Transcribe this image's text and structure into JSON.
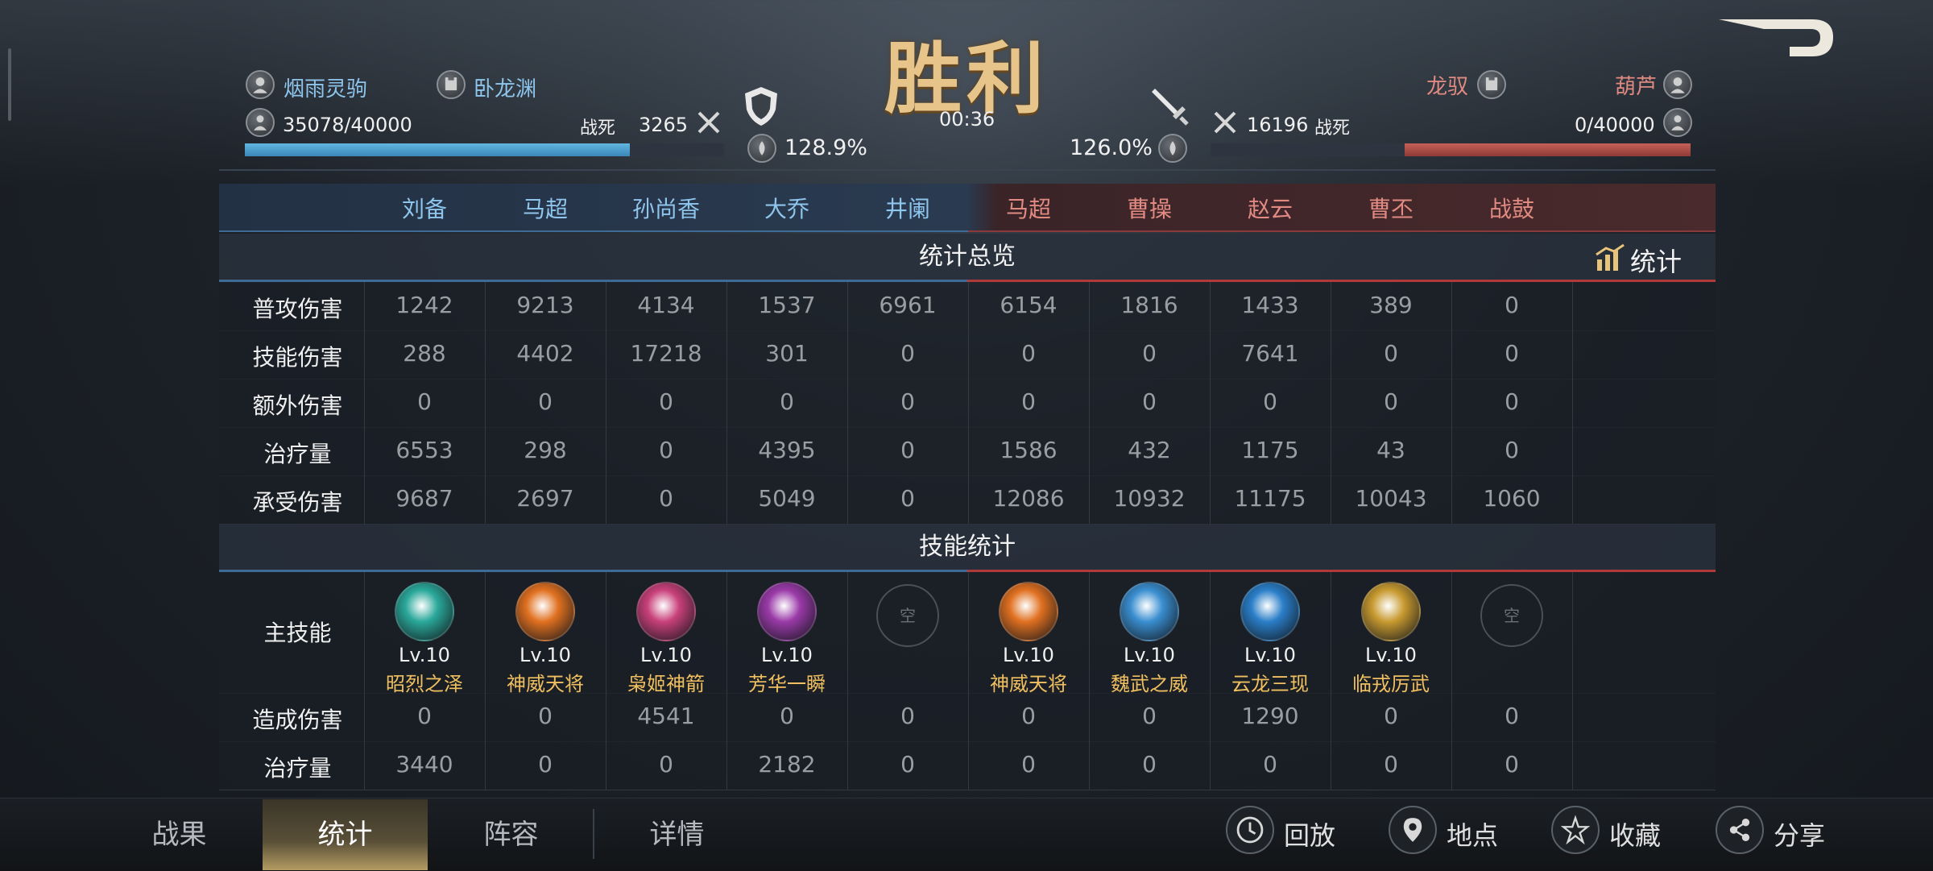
{
  "title": "胜利",
  "timer": "00:36",
  "left_team": {
    "player1": "烟雨灵驹",
    "player2": "卧龙渊",
    "troops": "35078/40000",
    "troops_fraction": 0.877,
    "kills_label": "战死",
    "kills_value": "3265",
    "percent": "128.9%"
  },
  "right_team": {
    "player1": "龙驭",
    "player2": "葫芦",
    "troops": "0/40000",
    "troops_fraction": 0.0,
    "kills_label": "战死",
    "kills_value": "16196",
    "percent": "126.0%"
  },
  "columns": [
    "刘备",
    "马超",
    "孙尚香",
    "大乔",
    "井阑",
    "马超",
    "曹操",
    "赵云",
    "曹丕",
    "战鼓"
  ],
  "overview": {
    "title": "统计总览",
    "stats_button": "统计",
    "rows": [
      {
        "label": "普攻伤害",
        "values": [
          "1242",
          "9213",
          "4134",
          "1537",
          "6961",
          "6154",
          "1816",
          "1433",
          "389",
          "0"
        ]
      },
      {
        "label": "技能伤害",
        "values": [
          "288",
          "4402",
          "17218",
          "301",
          "0",
          "0",
          "0",
          "7641",
          "0",
          "0"
        ]
      },
      {
        "label": "额外伤害",
        "values": [
          "0",
          "0",
          "0",
          "0",
          "0",
          "0",
          "0",
          "0",
          "0",
          "0"
        ]
      },
      {
        "label": "治疗量",
        "values": [
          "6553",
          "298",
          "0",
          "4395",
          "0",
          "1586",
          "432",
          "1175",
          "43",
          "0"
        ]
      },
      {
        "label": "承受伤害",
        "values": [
          "9687",
          "2697",
          "0",
          "5049",
          "0",
          "12086",
          "10932",
          "11175",
          "10043",
          "1060"
        ]
      }
    ]
  },
  "skills": {
    "title": "技能统计",
    "main_label": "主技能",
    "empty_text": "空",
    "entries": [
      {
        "lv": "Lv.10",
        "name": "昭烈之泽",
        "icon": "teal-sword-icon",
        "color": "#2aa89a"
      },
      {
        "lv": "Lv.10",
        "name": "神威天将",
        "icon": "fire-warrior-icon",
        "color": "#e07020"
      },
      {
        "lv": "Lv.10",
        "name": "枭姬神箭",
        "icon": "pink-arrows-icon",
        "color": "#c8407a"
      },
      {
        "lv": "Lv.10",
        "name": "芳华一瞬",
        "icon": "purple-petal-icon",
        "color": "#9a3aa8"
      },
      null,
      {
        "lv": "Lv.10",
        "name": "神威天将",
        "icon": "fire-warrior-icon",
        "color": "#e07020"
      },
      {
        "lv": "Lv.10",
        "name": "魏武之威",
        "icon": "blue-lord-icon",
        "color": "#3a8ed0"
      },
      {
        "lv": "Lv.10",
        "name": "云龙三现",
        "icon": "blue-dragon-icon",
        "color": "#2a7ec8"
      },
      {
        "lv": "Lv.10",
        "name": "临戎厉武",
        "icon": "gold-warrior-icon",
        "color": "#c89a30"
      },
      null
    ],
    "rows": [
      {
        "label": "造成伤害",
        "values": [
          "0",
          "0",
          "4541",
          "0",
          "0",
          "0",
          "0",
          "1290",
          "0",
          "0"
        ]
      },
      {
        "label": "治疗量",
        "values": [
          "3440",
          "0",
          "0",
          "2182",
          "0",
          "0",
          "0",
          "0",
          "0",
          "0"
        ]
      }
    ]
  },
  "tabs": [
    "战果",
    "统计",
    "阵容",
    "详情"
  ],
  "active_tab": "统计",
  "actions": [
    {
      "label": "回放",
      "icon": "replay-icon"
    },
    {
      "label": "地点",
      "icon": "location-pin-icon"
    },
    {
      "label": "收藏",
      "icon": "star-icon"
    },
    {
      "label": "分享",
      "icon": "share-icon"
    }
  ],
  "colors": {
    "blue_team": "#8ec5ec",
    "red_team": "#e08a82",
    "skill_name": "#f0c060",
    "victory": "#e6c48a"
  }
}
